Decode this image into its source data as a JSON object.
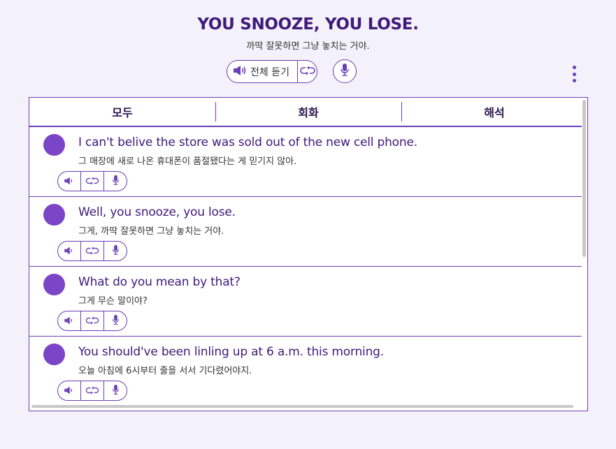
{
  "header": {
    "title": "YOU SNOOZE, YOU LOSE.",
    "subtitle": "까딱 잘못하면 그냥 놓치는 거야.",
    "play_all_label": "전체 듣기"
  },
  "icons": {
    "speaker": "speaker-icon",
    "loop": "loop-icon",
    "mic": "microphone-icon",
    "more": "more-vertical-icon"
  },
  "colors": {
    "accent": "#6b3fb5",
    "avatar": "#7a45c6",
    "title_text": "#3f1a7a",
    "background": "#f3f1f9"
  },
  "tabs": [
    {
      "label": "모두"
    },
    {
      "label": "회화"
    },
    {
      "label": "해석"
    }
  ],
  "dialogue": [
    {
      "en": "I can't belive the store was sold out of the new cell phone.",
      "ko": "그 매장에 새로 나온 휴대폰이 품절됐다는 게 믿기지 않아."
    },
    {
      "en": "Well, you snooze, you lose.",
      "ko": "그게, 까딱 잘못하면 그냥 놓치는 거야."
    },
    {
      "en": "What do you mean by that?",
      "ko": "그게 무슨 말이야?"
    },
    {
      "en": "You should've been linling up at 6 a.m. this morning.",
      "ko": "오늘 아침에 6시부터 줄을 서서 기다렸어야지."
    }
  ]
}
